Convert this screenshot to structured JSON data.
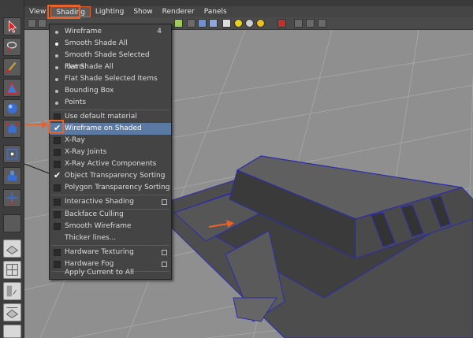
{
  "menubar": {
    "items": [
      "View",
      "Shading",
      "Lighting",
      "Show",
      "Renderer",
      "Panels"
    ]
  },
  "shading_menu": {
    "wireframe": "Wireframe",
    "wireframe_shortcut": "4",
    "smooth_shade_all": "Smooth Shade All",
    "smooth_shade_selected": "Smooth Shade Selected Items",
    "flat_shade_all": "Flat Shade All",
    "flat_shade_selected": "Flat Shade Selected Items",
    "bounding_box": "Bounding Box",
    "points": "Points",
    "use_default_material": "Use default material",
    "wireframe_on_shaded": "Wireframe on Shaded",
    "xray": "X-Ray",
    "xray_joints": "X-Ray Joints",
    "xray_active_components": "X-Ray Active Components",
    "object_transparency_sorting": "Object Transparency Sorting",
    "polygon_transparency_sorting": "Polygon Transparency Sorting",
    "interactive_shading": "Interactive Shading",
    "backface_culling": "Backface Culling",
    "smooth_wireframe": "Smooth Wireframe",
    "thicker_lines": "Thicker lines...",
    "hardware_texturing": "Hardware Texturing",
    "hardware_fog": "Hardware Fog",
    "apply_current_to_all": "Apply Current to All"
  },
  "colors": {
    "highlight": "#e8622a",
    "selection": "#5b7aa3",
    "wire": "#2b2bb0"
  },
  "icons": [
    "select-arrow-icon",
    "lasso-icon",
    "paint-brush-icon",
    "move-icon",
    "rotate-icon",
    "scale-icon",
    "manipulator-icon",
    "joint-icon",
    "layout-icon"
  ]
}
